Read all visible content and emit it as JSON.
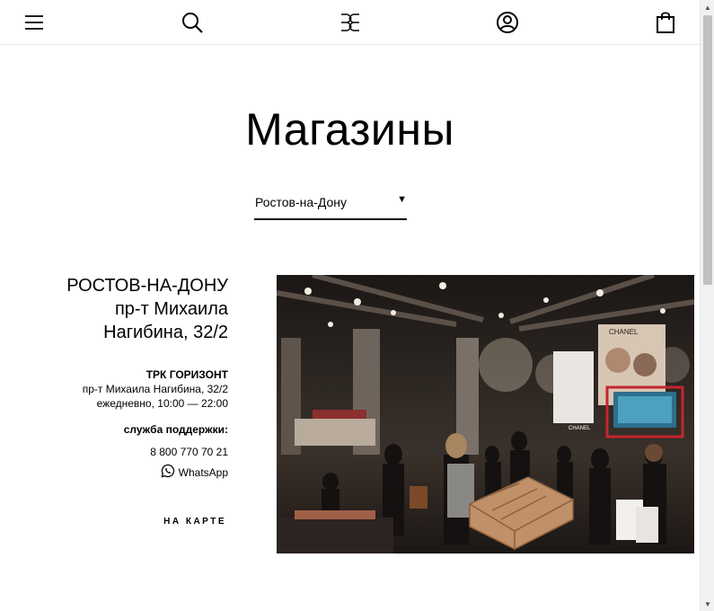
{
  "header": {
    "menu_icon": "hamburger-menu-icon",
    "search_icon": "search-icon",
    "logo_icon": "logo-icon",
    "account_icon": "account-icon",
    "cart_icon": "shopping-bag-icon"
  },
  "page": {
    "title": "Магазины"
  },
  "city_select": {
    "value": "Ростов-на-Дону",
    "caret": "▼"
  },
  "store": {
    "city": "РОСТОВ-НА-ДОНУ",
    "address": "пр-т Михаила Нагибина, 32/2",
    "mall": "ТРК ГОРИЗОНТ",
    "mall_address": "пр-т Михаила Нагибина, 32/2",
    "hours": "ежедневно, 10:00 — 22:00",
    "support_label": "служба поддержки:",
    "phone": "8 800 770 70 21",
    "whatsapp": "WhatsApp",
    "map_link": "НА КАРТЕ",
    "photo_signs": [
      "CHANEL",
      "CHANEL"
    ]
  },
  "colors": {
    "text": "#000000",
    "divider": "#e8e8e8",
    "scrollbar_track": "#f1f1f1",
    "scrollbar_thumb": "#c1c1c1"
  }
}
